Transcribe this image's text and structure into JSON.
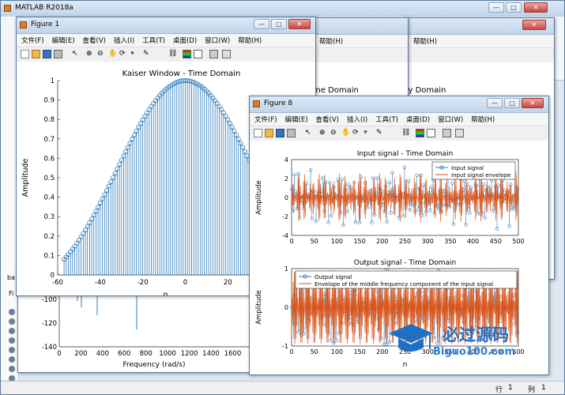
{
  "main_window": {
    "title": "MATLAB R2018a"
  },
  "figure1": {
    "title": "Figure 1",
    "menus": [
      "文件(F)",
      "编辑(E)",
      "查看(V)",
      "插入(I)",
      "工具(T)",
      "桌面(D)",
      "窗口(W)",
      "帮助(H)"
    ]
  },
  "figure8": {
    "title": "Figure 8",
    "menus": [
      "文件(F)",
      "编辑(E)",
      "查看(V)",
      "插入(I)",
      "工具(T)",
      "桌面(D)",
      "窗口(W)",
      "帮助(H)"
    ]
  },
  "behind": {
    "menu_help": "帮助(H)",
    "title_a": "me Domain",
    "title_b": "cy Domain",
    "side_label_a": "ba",
    "side_label_b": "Fi"
  },
  "bg_plot": {
    "yticks": [
      "-100",
      "-120",
      "-140"
    ],
    "xticks": [
      "0",
      "200",
      "400",
      "600",
      "800",
      "1000",
      "1200",
      "1400",
      "1600",
      "1700"
    ],
    "xlabel": "Frequency (rad/s)"
  },
  "chart_data": [
    {
      "type": "stem",
      "title": "Kaiser Window - Time Domain",
      "xlabel": "n",
      "ylabel": "Amplitude",
      "xlim": [
        -60,
        60
      ],
      "ylim": [
        0,
        1
      ],
      "xticks": [
        "-60",
        "-40",
        "-20",
        "0",
        "20",
        "40"
      ],
      "yticks": [
        "0",
        "0.1",
        "0.2",
        "0.3",
        "0.4",
        "0.5",
        "0.6",
        "0.7",
        "0.8",
        "0.9",
        "1"
      ],
      "description_of_series": "Kaiser window samples n=-57..57, peak 1 at n=0, 0.08 at edges",
      "n_min": -57,
      "n_max": 57,
      "edge_value": 0.08,
      "color": "#2d7cbc"
    },
    {
      "type": "stem+line",
      "title": "Input signal - Time Domain",
      "xlabel": "",
      "ylabel": "Amplitude",
      "xlim": [
        0,
        500
      ],
      "ylim": [
        -4,
        4
      ],
      "xticks": [
        "0",
        "50",
        "100",
        "150",
        "200",
        "250",
        "300",
        "350",
        "400",
        "450",
        "500"
      ],
      "yticks": [
        "4",
        "2",
        "0",
        "-2",
        "-4"
      ],
      "legend": [
        "Input signal",
        "Input signal envelope"
      ],
      "legend_position": "top-right",
      "colors": [
        "#2d7cbc",
        "#d95319"
      ]
    },
    {
      "type": "stem+line",
      "title": "Output signal - Time Domain",
      "xlabel": "n",
      "ylabel": "Amplitude",
      "xlim": [
        0,
        500
      ],
      "ylim": [
        -1,
        1
      ],
      "xticks": [
        "0",
        "50",
        "100",
        "150",
        "200",
        "250",
        "300",
        "350",
        "400",
        "450",
        "500"
      ],
      "yticks": [
        "1",
        "0",
        "-1"
      ],
      "legend": [
        "Output signal",
        "Envelope of the middle frequency component of the input signal"
      ],
      "legend_position": "top-left",
      "colors": [
        "#2d7cbc",
        "#d95319"
      ]
    }
  ],
  "status_bar": {
    "row_label": "行",
    "row_value": "1",
    "col_label": "列",
    "col_value": "1"
  },
  "watermark": {
    "title": "必过源码",
    "url": "Biguo100.com"
  }
}
